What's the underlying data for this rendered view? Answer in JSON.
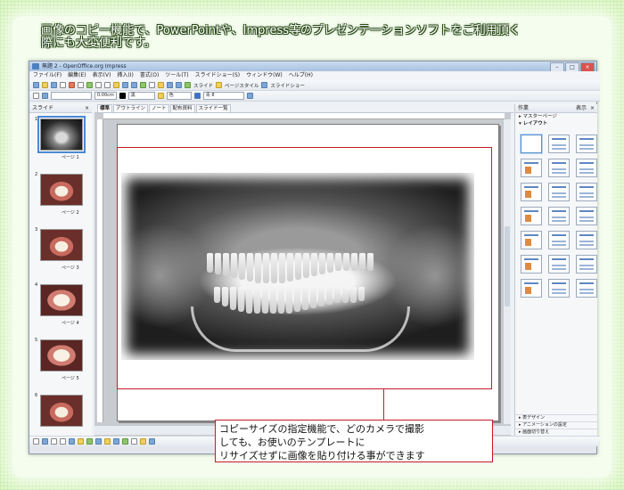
{
  "caption": {
    "line1": "画像のコピー機能で、PowerPointや、Impress等のプレゼンテーションソフトをご利用頂く",
    "line2": "際にも大変便利です。"
  },
  "window": {
    "title": "無題 2 - OpenOffice.org Impress",
    "buttons": [
      "–",
      "□",
      "×"
    ]
  },
  "menu": [
    "ファイル(F)",
    "編集(E)",
    "表示(V)",
    "挿入(I)",
    "書式(O)",
    "ツール(T)",
    "スライドショー(S)",
    "ウィンドウ(W)",
    "ヘルプ(H)"
  ],
  "toolbar1": {
    "slide_label": "スライド",
    "page_style_label": "ページスタイル",
    "slideshow_label": "スライドショー"
  },
  "toolbar2": {
    "line_width": "0.00cm",
    "color_black": "黒",
    "color_label": "色",
    "color_blue": "青 8"
  },
  "slides_pane": {
    "title": "スライド",
    "close": "×",
    "items": [
      {
        "number": "1",
        "label": "ページ 1",
        "kind": "xray"
      },
      {
        "number": "2",
        "label": "ページ 2",
        "kind": "teeth"
      },
      {
        "number": "3",
        "label": "ページ 3",
        "kind": "teeth"
      },
      {
        "number": "4",
        "label": "ページ 4",
        "kind": "teeth2"
      },
      {
        "number": "5",
        "label": "ページ 5",
        "kind": "teeth2"
      },
      {
        "number": "6",
        "label": "",
        "kind": "teeth"
      }
    ]
  },
  "view_tabs": [
    "標準",
    "アウトライン",
    "ノート",
    "配布資料",
    "スライド一覧"
  ],
  "tasks_pane": {
    "title": "作業",
    "view_label": "表示",
    "close": "×",
    "master_pages": "マスターページ",
    "layouts": "レイアウト",
    "table_design": "表デザイン",
    "custom_animation": "アニメーションの設定",
    "slide_transition": "画面切り替え"
  },
  "callout": {
    "line1": "コピーサイズの指定機能で、どのカメラで撮影",
    "line2": "しても、お使いのテンプレートに",
    "line3": "リサイズせずに画像を貼り付ける事ができます"
  },
  "colors": {
    "accent_red": "#c8192b",
    "selection_blue": "#4a8ad4"
  }
}
